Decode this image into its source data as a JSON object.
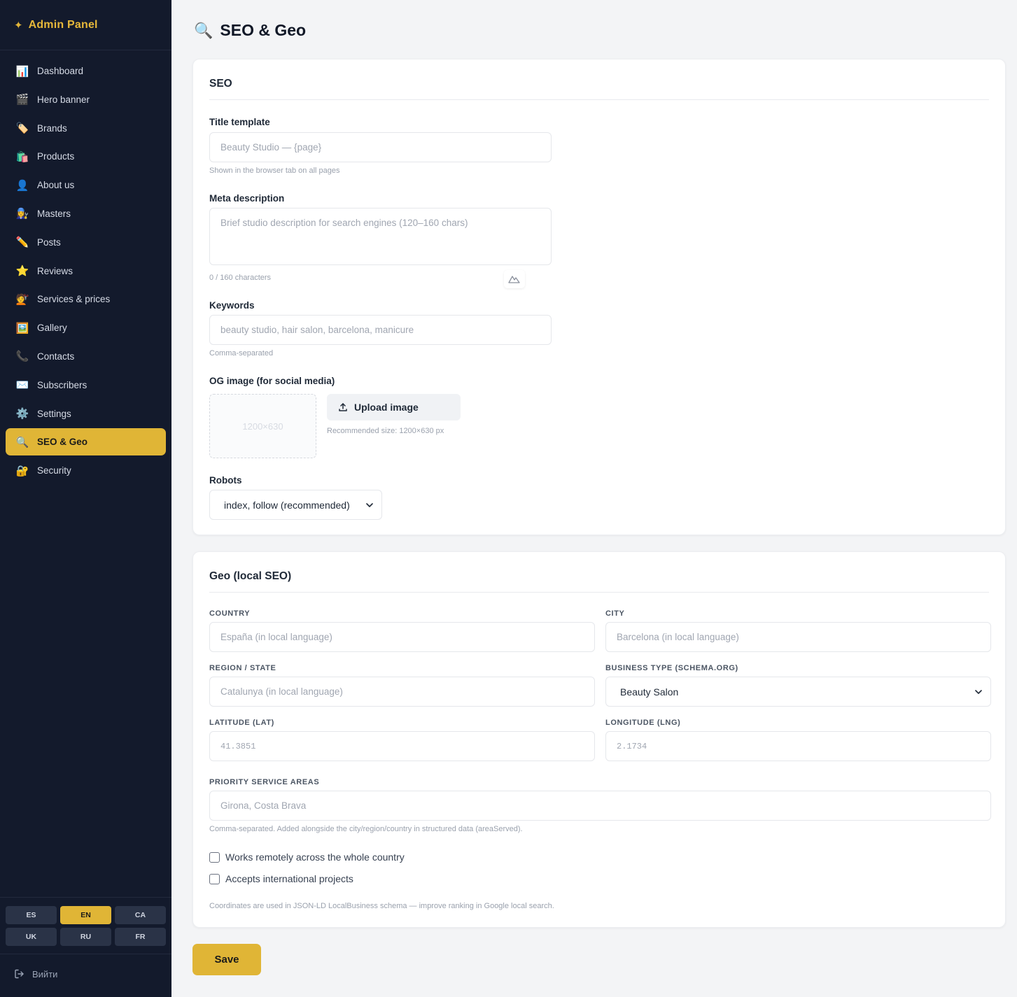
{
  "sidebar": {
    "brand": {
      "icon": "sparkle-icon",
      "title": "Admin Panel"
    },
    "items": [
      {
        "label": "Dashboard",
        "icon": "📊"
      },
      {
        "label": "Hero banner",
        "icon": "🎬"
      },
      {
        "label": "Brands",
        "icon": "🏷️"
      },
      {
        "label": "Products",
        "icon": "🛍️"
      },
      {
        "label": "About us",
        "icon": "👤"
      },
      {
        "label": "Masters",
        "icon": "👩‍🔧"
      },
      {
        "label": "Posts",
        "icon": "✏️"
      },
      {
        "label": "Reviews",
        "icon": "⭐"
      },
      {
        "label": "Services & prices",
        "icon": "💇"
      },
      {
        "label": "Gallery",
        "icon": "🖼️"
      },
      {
        "label": "Contacts",
        "icon": "📞"
      },
      {
        "label": "Subscribers",
        "icon": "✉️"
      },
      {
        "label": "Settings",
        "icon": "⚙️"
      },
      {
        "label": "SEO & Geo",
        "icon": "🔍"
      },
      {
        "label": "Security",
        "icon": "🔐"
      }
    ],
    "active_item": "SEO & Geo",
    "languages": [
      "ES",
      "EN",
      "CA",
      "UK",
      "RU",
      "FR"
    ],
    "active_language": "EN",
    "logout_label": "Вийти"
  },
  "page": {
    "title_icon": "🔍",
    "title": "SEO & Geo"
  },
  "seo": {
    "heading": "SEO",
    "title_template": {
      "label": "Title template",
      "placeholder": "Beauty Studio — {page}",
      "value": "",
      "hint": "Shown in the browser tab on all pages"
    },
    "meta_description": {
      "label": "Meta description",
      "placeholder": "Brief studio description for search engines (120–160 chars)",
      "value": "",
      "counter": "0 / 160 characters"
    },
    "keywords": {
      "label": "Keywords",
      "placeholder": "beauty studio, hair salon, barcelona, manicure",
      "value": "",
      "hint": "Comma-separated"
    },
    "og_image": {
      "label": "OG image (for social media)",
      "placeholder_text": "1200×630",
      "upload_label": "Upload image",
      "hint": "Recommended size: 1200×630 px"
    },
    "robots": {
      "label": "Robots",
      "selected": "index, follow (recommended)"
    }
  },
  "geo": {
    "heading": "Geo (local SEO)",
    "country": {
      "label": "Country",
      "placeholder": "España (in local language)",
      "value": ""
    },
    "city": {
      "label": "City",
      "placeholder": "Barcelona (in local language)",
      "value": ""
    },
    "region": {
      "label": "Region / State",
      "placeholder": "Catalunya (in local language)",
      "value": ""
    },
    "business_type": {
      "label": "Business type (Schema.org)",
      "selected": "Beauty Salon"
    },
    "latitude": {
      "label": "Latitude (lat)",
      "placeholder": "41.3851",
      "value": ""
    },
    "longitude": {
      "label": "Longitude (lng)",
      "placeholder": "2.1734",
      "value": ""
    },
    "service_areas": {
      "label": "Priority service areas",
      "placeholder": "Girona, Costa Brava",
      "value": "",
      "hint": "Comma-separated. Added alongside the city/region/country in structured data (areaServed)."
    },
    "remote_checkbox": {
      "label": "Works remotely across the whole country",
      "checked": false
    },
    "international_checkbox": {
      "label": "Accepts international projects",
      "checked": false
    },
    "footer_note": "Coordinates are used in JSON-LD LocalBusiness schema — improve ranking in Google local search."
  },
  "actions": {
    "save_label": "Save"
  },
  "colors": {
    "accent": "#e0b536",
    "sidebar_bg": "#131a2c",
    "page_bg": "#f3f4f6"
  }
}
